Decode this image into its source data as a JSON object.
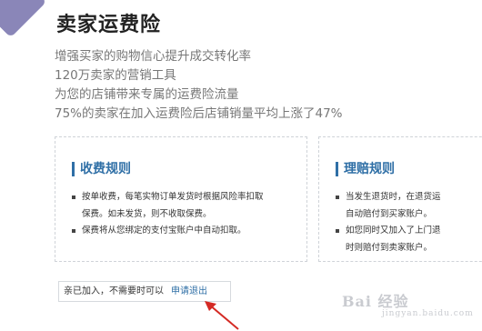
{
  "header": {
    "title": "卖家运费险"
  },
  "benefits": [
    "增强买家的购物信心提升成交转化率",
    "120万卖家的营销工具",
    "为您的店铺带来专属的运费险流量",
    "75%的卖家在加入运费险后店铺销量平均上涨了47%"
  ],
  "fee_rules": {
    "title": "收费规则",
    "items": [
      "按单收费，每笔实物订单发货时根据风险率扣取",
      "保费。如未发货，则不收取保费。",
      "保费将从您绑定的支付宝账户中自动扣取。"
    ]
  },
  "claim_rules": {
    "title": "理赔规则",
    "items": [
      "当发生退货时，在退货运",
      "自动赔付到买家账户。",
      "如您同时又加入了上门退",
      "时则赔付到卖家账户。"
    ]
  },
  "status": {
    "joined_text": "亲已加入，不需要时可以",
    "exit_link": "申请退出"
  },
  "watermark": {
    "brand": "Bai 经验",
    "site": "jingyan.baidu.com"
  },
  "colors": {
    "accent": "#2f6fa6",
    "arrow": "#d42a24",
    "logo_purple": "#8a86b8",
    "logo_yellow": "#f3cf4a"
  }
}
